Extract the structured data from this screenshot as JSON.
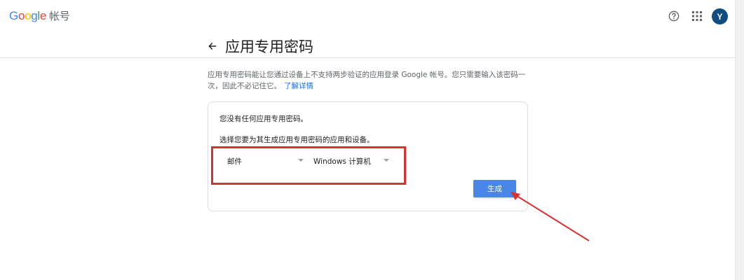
{
  "header": {
    "logo_text": [
      "G",
      "o",
      "o",
      "g",
      "l",
      "e"
    ],
    "product_name": "帐号",
    "avatar_letter": "Y"
  },
  "page": {
    "title": "应用专用密码",
    "description": "应用专用密码能让您通过设备上不支持两步验证的应用登录 Google 帐号。您只需要输入该密码一次，因此不必记住它。",
    "learn_more": "了解详情"
  },
  "card": {
    "no_passwords": "您没有任何应用专用密码。",
    "select_prompt": "选择您要为其生成应用专用密码的应用和设备。",
    "app_select": "邮件",
    "device_select": "Windows 计算机",
    "generate_label": "生成"
  },
  "colors": {
    "accent": "#4a85e8",
    "highlight": "#d93030",
    "avatar_bg": "#0f4c81"
  },
  "icons": {
    "help": "help-circle-icon",
    "apps": "apps-grid-icon",
    "back": "arrow-left-icon"
  }
}
